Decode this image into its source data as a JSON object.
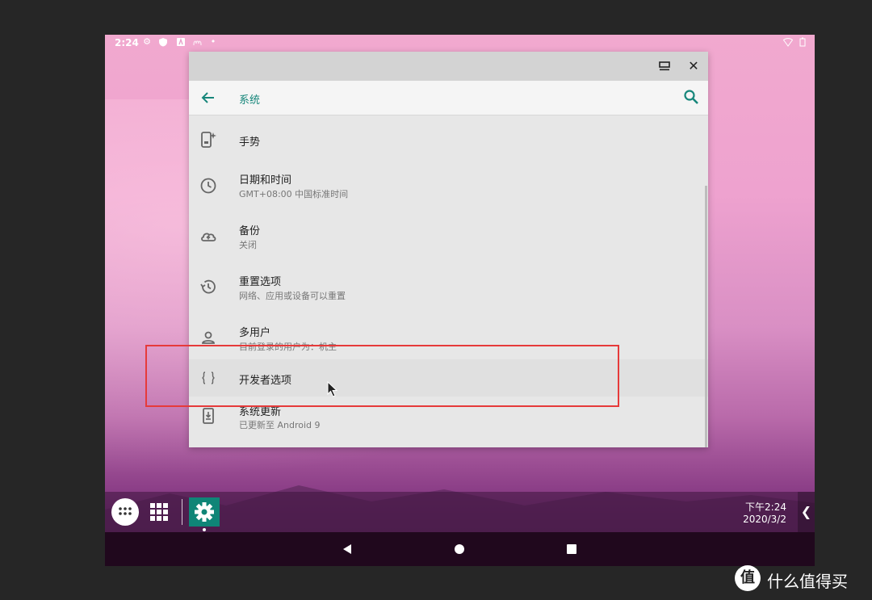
{
  "status_bar": {
    "time": "2:24"
  },
  "window": {
    "app_bar": {
      "title": "系统"
    },
    "items": [
      {
        "title": "手势",
        "subtitle": "",
        "icon": "gesture-phone-icon"
      },
      {
        "title": "日期和时间",
        "subtitle": "GMT+08:00 中国标准时间",
        "icon": "clock-icon"
      },
      {
        "title": "备份",
        "subtitle": "关闭",
        "icon": "cloud-upload-icon"
      },
      {
        "title": "重置选项",
        "subtitle": "网络、应用或设备可以重置",
        "icon": "history-icon"
      },
      {
        "title": "多用户",
        "subtitle": "目前登录的用户为：机主",
        "icon": "person-icon"
      },
      {
        "title": "开发者选项",
        "subtitle": "",
        "icon": "braces-icon"
      },
      {
        "title": "系统更新",
        "subtitle": "已更新至 Android 9",
        "icon": "system-update-icon"
      }
    ]
  },
  "taskbar": {
    "time": "下午2:24",
    "date": "2020/3/2"
  },
  "watermark": {
    "text": "什么值得买",
    "logo": "值"
  },
  "colors": {
    "accent": "#16867a",
    "annotation": "#e63a3a",
    "taskbar_app": "#0f8577"
  }
}
